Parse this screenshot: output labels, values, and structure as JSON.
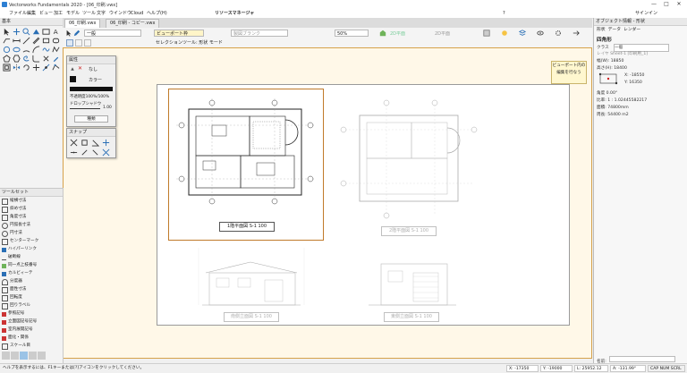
{
  "window": {
    "title": "Vectorworks Fundamentals 2020 - [06_印刷.vwx]",
    "controls": [
      "—",
      "□",
      "✕"
    ]
  },
  "menu": [
    "ファイル",
    "編集",
    "ビュー",
    "加工",
    "モデル",
    "ツール",
    "文字",
    "ウインドウ",
    "Cloud",
    "ヘルプ(H)"
  ],
  "resource_manager": {
    "title": "リソースマネージャ"
  },
  "signin": {
    "label": "サインイン"
  },
  "left_palette": {
    "title": "基本"
  },
  "document_tabs": [
    {
      "label": "06_印刷.vwx",
      "active": true
    },
    {
      "label": "06_印刷 - コピー.vwx",
      "active": false
    }
  ],
  "view_bar": {
    "class": "一般",
    "viewport": "ビューポート枠",
    "layer": "製図ブランク",
    "scale": "50%",
    "view": "2D平面",
    "view2": "2D平面"
  },
  "mode_bar": {
    "label": "セレクションツール: 形状 モード"
  },
  "attributes": {
    "title": "属性",
    "fill": "なし",
    "pen": "カラー",
    "opacity": "不透明度100%/100%",
    "drop_shadow": "ドロップシャドウ",
    "line_value": "1.00",
    "button": "種類"
  },
  "snap": {
    "title": "スナップ"
  },
  "toolset": {
    "title": "ツールセット",
    "items": [
      "縦横寸法",
      "斜め寸法",
      "角度寸法",
      "円弧長寸法",
      "円寸法",
      "センターマーク",
      "ハイパーリンク",
      "破断線",
      "同一点上枝番号",
      "カルビィーテ",
      "分度器",
      "面性寸法",
      "回転度",
      "回りラベル",
      "参照記号",
      "立面図記号記号",
      "室内展開記号",
      "面化・関係",
      "スケール目"
    ]
  },
  "viewport_button": {
    "label": "ビューポート内の編集を行なう"
  },
  "drawings": {
    "captions": [
      "1階平面図 S-1 100",
      "2階平面図 S-1 100",
      "南側立面図 S-1 100",
      "東側立面図 S-1 100"
    ]
  },
  "obj_info": {
    "title": "オブジェクト情報 - 形状",
    "tabs": [
      "形状",
      "データ",
      "レンダー"
    ],
    "object_type": "四角形",
    "rows": [
      {
        "label": "クラス",
        "value": "一般"
      },
      {
        "label": "レイヤ",
        "value": "Sheet-1 [印刷用_1]"
      },
      {
        "label": "幅(W):",
        "value": "18850"
      },
      {
        "label": "高さ(H):",
        "value": "18400"
      },
      {
        "label": "X:",
        "value": "-18550"
      },
      {
        "label": "Y:",
        "value": "16350"
      },
      {
        "label": "角度",
        "value": "0.00°"
      },
      {
        "label": "比率:",
        "value": "1 : 1.02445582217"
      },
      {
        "label": "面積:",
        "value": "74800mm"
      },
      {
        "label": "周長:",
        "value": "54400 m2"
      }
    ],
    "name_label": "名前:"
  },
  "status": {
    "hint": "ヘルプを表示するには、F1キーまたは[?]アイコンをクリックしてください。",
    "x": "X: -17350",
    "y": "Y: -19000",
    "l": "L: 25952.12",
    "a": "A: -131.99°",
    "snap": "CAP NUM SCRL"
  }
}
